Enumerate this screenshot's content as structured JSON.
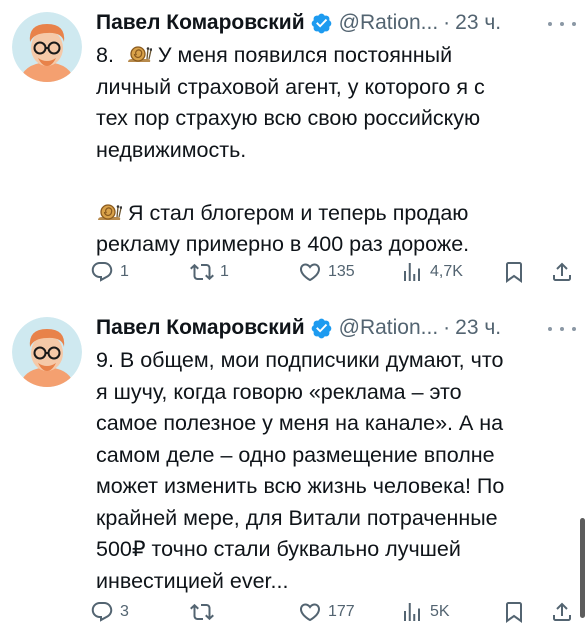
{
  "tweets": [
    {
      "author_name": "Павел Комаровский",
      "handle": "@Ration...",
      "separator": "·",
      "time": "23 ч.",
      "lines": [
        "8.",
        "У меня появился постоянный",
        "личный страховой агент, у которого я с",
        "тех пор страхую всю свою российскую",
        "недвижимость.",
        "Я стал блогером и теперь продаю",
        "рекламу примерно в 400 раз дороже."
      ],
      "replies": "1",
      "retweets": "1",
      "likes": "135",
      "views": "4,7K"
    },
    {
      "author_name": "Павел Комаровский",
      "handle": "@Ration...",
      "separator": "·",
      "time": "23 ч.",
      "lines": [
        "9. В общем, мои подписчики думают, что",
        "я шучу, когда говорю «реклама – это",
        "самое полезное у меня на канале». А на",
        "самом деле – одно размещение вполне",
        "может изменить всю жизнь человека! По",
        "крайней мере, для Витали потраченные",
        "500₽ точно стали буквально лучшей",
        "инвестицией ever..."
      ],
      "replies": "3",
      "retweets": "",
      "likes": "177",
      "views": "5K"
    }
  ],
  "icons": {
    "avatar": "avatar-illustration",
    "verified": "verified-badge-icon",
    "snail": "snail-emoji-icon",
    "reply": "reply-icon",
    "retweet": "retweet-icon",
    "like": "heart-icon",
    "views": "views-icon",
    "bookmark": "bookmark-icon",
    "share": "share-icon",
    "more": "more-options-icon"
  },
  "colors": {
    "text": "#0f1419",
    "secondary": "#536471",
    "verified": "#1d9bf0",
    "avatar_bg": "#cfe9f0",
    "hair": "#e8824a"
  }
}
